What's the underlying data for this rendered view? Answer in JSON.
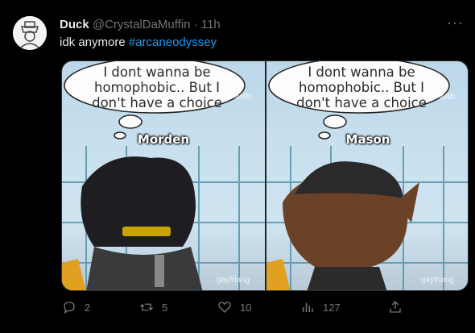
{
  "tweet": {
    "author_name": "Duck",
    "handle": "@CrystalDaMuffin",
    "separator": "·",
    "time": "11h",
    "more": "···",
    "text": "idk anymore",
    "hashtag": "#arcaneodyssey"
  },
  "media": {
    "panels": [
      {
        "bubble_lines": [
          "I dont wanna be",
          "homophobic.. But I",
          "don't have a choice"
        ],
        "watermark_made": "Made with",
        "character_name": "Morden",
        "watermark_bottom": "gayfriang"
      },
      {
        "bubble_lines": [
          "I dont wanna be",
          "homophobic.. But I",
          "don't have a choice"
        ],
        "watermark_made": "Made with",
        "character_name": "Mason",
        "watermark_bottom": "gayfriang"
      }
    ]
  },
  "actions": {
    "reply_count": "2",
    "retweet_count": "5",
    "like_count": "10",
    "view_count": "127"
  },
  "icons": {
    "reply": "reply-icon",
    "retweet": "retweet-icon",
    "like": "heart-icon",
    "views": "views-icon",
    "share": "share-icon"
  }
}
